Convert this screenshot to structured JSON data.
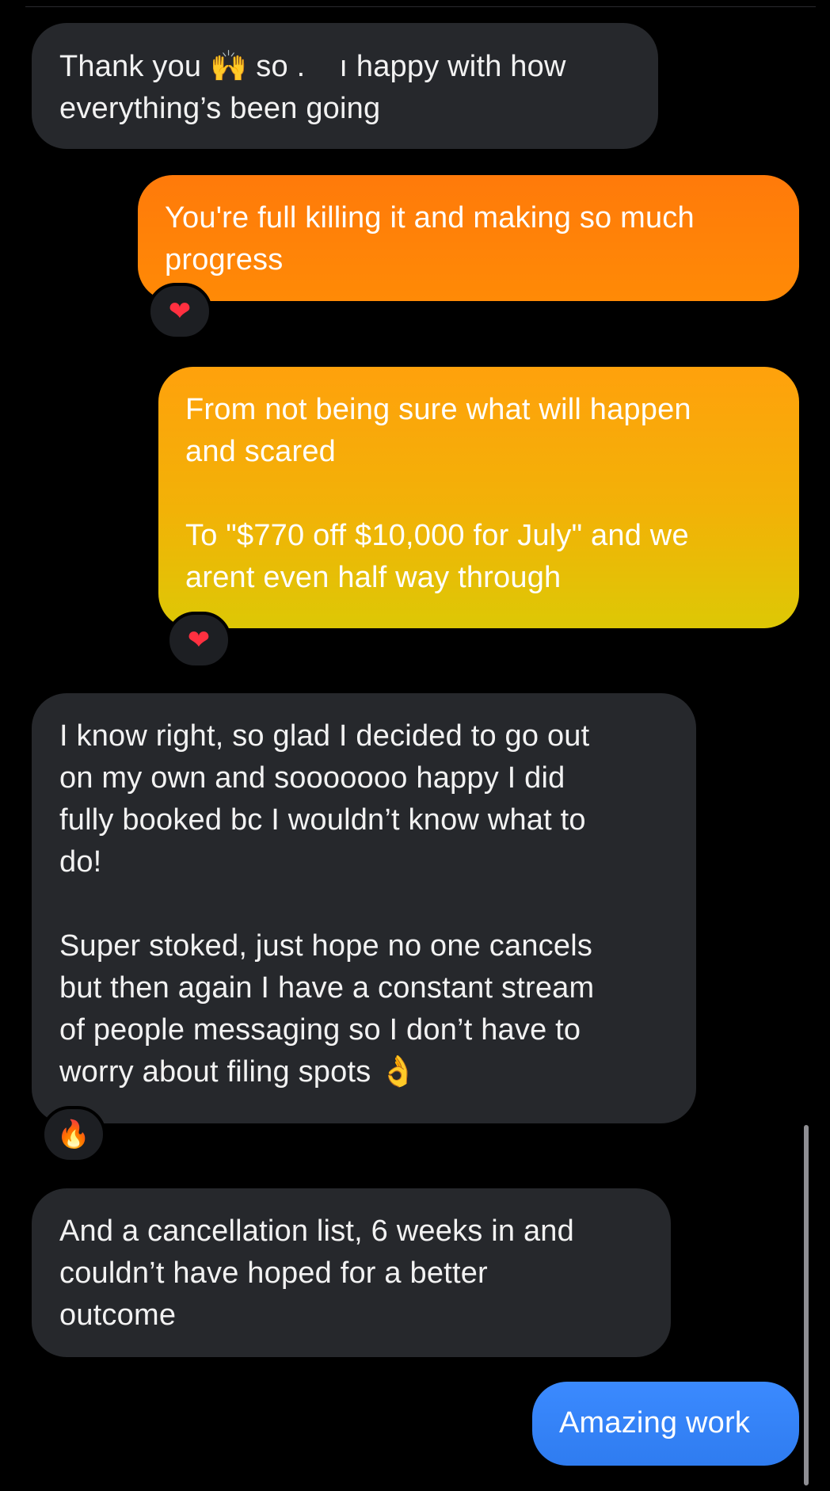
{
  "conversation": {
    "messages": [
      {
        "direction": "incoming",
        "text_before_emoji": "Thank you ",
        "emoji": "🙌",
        "text_after_emoji": " so .    ı happy with how\neverything’s been going"
      },
      {
        "direction": "outgoing",
        "text": "You're full killing it and making so much\nprogress",
        "reaction": "❤"
      },
      {
        "direction": "outgoing",
        "text": "From not being sure what will happen\nand scared\n\nTo \"$770 off $10,000 for July\" and we\narent even half way through",
        "reaction": "❤"
      },
      {
        "direction": "incoming",
        "text_before_emoji": "I know right, so glad I decided to go out\non my own and sooooooo happy I did\nfully booked bc I wouldn’t know what to\ndo!\n\nSuper stoked, just hope no one cancels\nbut then again I have a constant stream\nof people messaging so I don’t have to\nworry about filing spots ",
        "emoji": "👌",
        "reaction": "🔥"
      },
      {
        "direction": "incoming",
        "text": "And a cancellation list, 6 weeks in and\ncouldn’t have hoped for a better\noutcome"
      },
      {
        "direction": "outgoing",
        "text": "Amazing work"
      }
    ]
  },
  "colors": {
    "background": "#000000",
    "incoming_bubble": "#26282c",
    "outgoing_orange": "#ff7a0a",
    "outgoing_yellow": "#f2b207",
    "outgoing_blue": "#3b8aff"
  }
}
